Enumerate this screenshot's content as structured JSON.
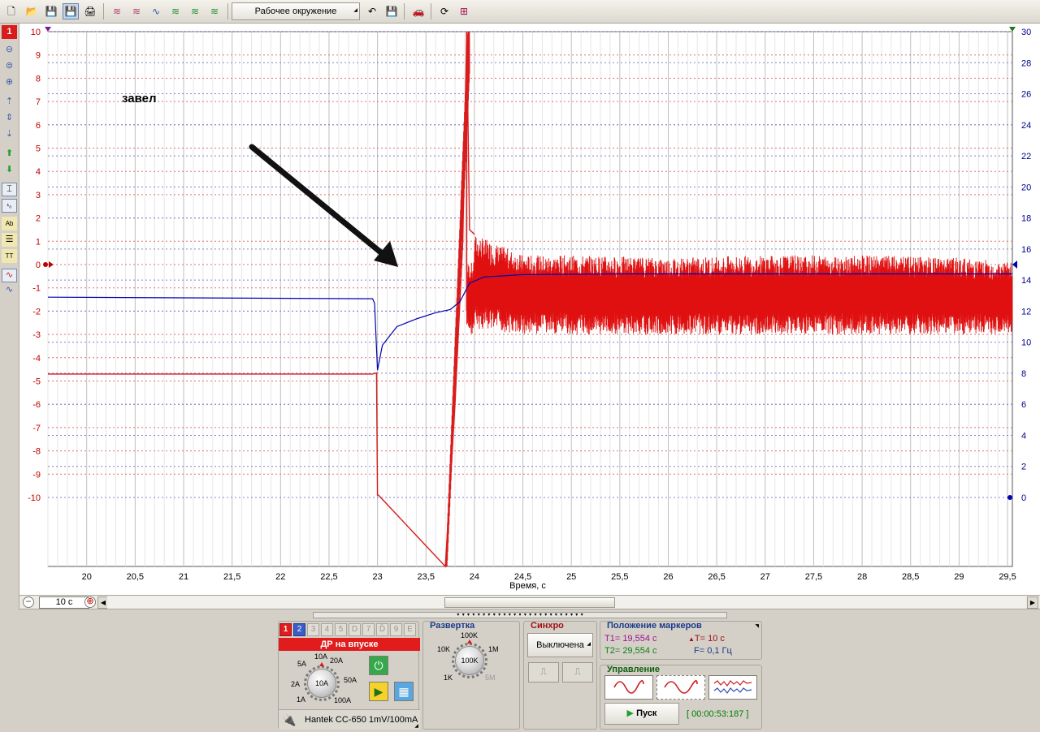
{
  "toolbar": {
    "environment_label": "Рабочее окружение"
  },
  "sidebar": {
    "channel_number": "1"
  },
  "plot": {
    "annotation": "завел",
    "x_axis_label": "Время, с",
    "left_ticks": [
      "10",
      "9",
      "8",
      "7",
      "6",
      "5",
      "4",
      "3",
      "2",
      "1",
      "0",
      "-1",
      "-2",
      "-3",
      "-4",
      "-5",
      "-6",
      "-7",
      "-8",
      "-9",
      "-10"
    ],
    "right_ticks": [
      "30",
      "28",
      "26",
      "24",
      "22",
      "20",
      "18",
      "16",
      "14",
      "12",
      "10",
      "8",
      "6",
      "4",
      "2",
      "0"
    ],
    "x_ticks": [
      "20",
      "20,5",
      "21",
      "21,5",
      "22",
      "22,5",
      "23",
      "23,5",
      "24",
      "24,5",
      "25",
      "25,5",
      "26",
      "26,5",
      "27",
      "27,5",
      "28",
      "28,5",
      "29",
      "29,5"
    ]
  },
  "chart_data": {
    "type": "line",
    "x_label": "Время, с",
    "xlim": [
      19.6,
      29.55
    ],
    "left_axis": {
      "color": "#d81c1c",
      "range": [
        -10,
        10
      ]
    },
    "right_axis": {
      "color": "#0000b4",
      "range": [
        0,
        30
      ]
    },
    "grid": true,
    "series": [
      {
        "color": "#d81c1c",
        "axis": "left",
        "x": [
          19.6,
          22.95,
          22.99,
          23.0,
          23.01,
          23.7,
          23.8,
          23.88,
          23.92,
          23.95,
          24.0,
          24.1,
          24.3,
          24.6,
          25.0,
          26.0,
          27.0,
          28.0,
          29.0,
          29.55
        ],
        "y": [
          -4.7,
          -4.7,
          -4.65,
          -9.9,
          -9.9,
          -14,
          -6,
          1,
          10,
          1.5,
          1.3,
          0.8,
          0.5,
          0.2,
          0.0,
          0.0,
          0.0,
          0.0,
          0.0,
          0.0
        ],
        "noise_envelope": {
          "x": [
            24.0,
            24.5,
            25.0,
            26.0,
            27.0,
            28.0,
            29.0,
            29.55
          ],
          "y_min": [
            -2.8,
            -3.0,
            -3.0,
            -3.0,
            -3.0,
            -3.0,
            -3.0,
            -3.0
          ],
          "y_max": [
            1.3,
            0.4,
            0.4,
            0.3,
            0.4,
            0.4,
            0.3,
            0.1
          ]
        }
      },
      {
        "color": "#0000b4",
        "axis": "right",
        "x": [
          19.6,
          22.95,
          22.97,
          23.0,
          23.05,
          23.2,
          23.4,
          23.6,
          23.75,
          23.85,
          23.95,
          24.1,
          24.5,
          25.5,
          29.55
        ],
        "y": [
          12.9,
          12.8,
          12.5,
          8.2,
          9.8,
          11.0,
          11.5,
          11.9,
          12.1,
          12.6,
          13.8,
          14.2,
          14.35,
          14.4,
          14.4
        ]
      }
    ]
  },
  "bottom": {
    "timebase_value": "10 с",
    "channel_tabs": [
      "1",
      "2",
      "3",
      "4",
      "5",
      "D",
      "7",
      "D̄",
      "9",
      "E"
    ],
    "channel_name": "ДР на впуске",
    "range_labels": {
      "r10a_top": "10A",
      "r5a": "5A",
      "r20a": "20A",
      "r2a": "2A",
      "r50a": "50A",
      "r1a": "1A",
      "r100a": "100A",
      "center": "10A"
    },
    "probe_label": "Hantek CC-650 1mV/100mA",
    "timebase_title": "Развертка",
    "timebase_labels": {
      "t100k_top": "100K",
      "t10k": "10K",
      "t1m": "1M",
      "t1k": "1K",
      "t5m": "5M",
      "center": "100K"
    },
    "sync_title": "Синхро",
    "sync_state": "Выключена",
    "markers_title": "Положение маркеров",
    "t1": "T1= 19,554 с",
    "t2": "T2= 29,554 с",
    "dt": "T= 10 с",
    "freq": "F= 0,1 Гц",
    "control_title": "Управление",
    "run_label": "Пуск",
    "elapsed": "[ 00:00:53:187 ]"
  }
}
